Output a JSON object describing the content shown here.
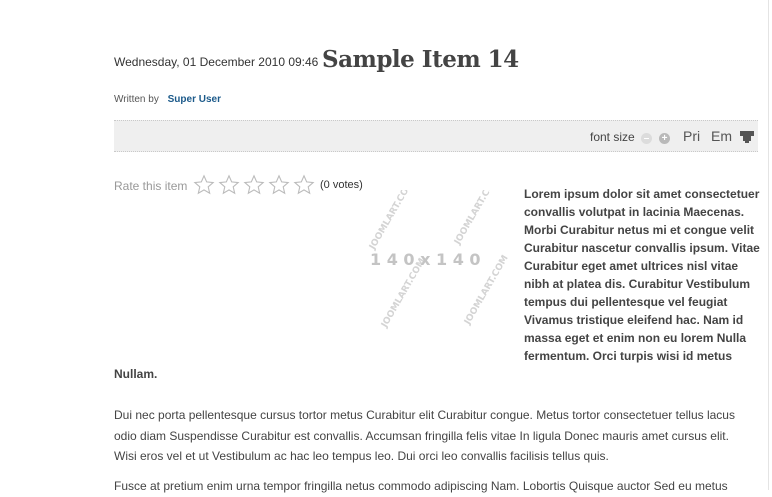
{
  "article": {
    "date": "Wednesday, 01 December 2010 09:46",
    "title": "Sample Item 14",
    "written_by_label": "Written by",
    "author": "Super User"
  },
  "toolbar": {
    "font_size_label": "font size",
    "decrease_icon": "minus-circle-icon",
    "increase_icon": "plus-circle-icon",
    "print_label": "Pri",
    "email_label": "Em",
    "tool_icon": "toolbox-icon"
  },
  "rating": {
    "label": "Rate this item",
    "star_count": 5,
    "votes": "(0 votes)"
  },
  "image": {
    "dimension_text": "1 4 0 x 1 4 0",
    "watermark": "JOOMLART.COM"
  },
  "content": {
    "sidebar_text": "Lorem ipsum dolor sit amet consectetuer convallis volutpat in lacinia Maecenas. Morbi Curabitur netus mi et congue velit Curabitur nascetur convallis ipsum. Vitae Curabitur eget amet ultrices nisl vitae nibh at platea dis. Curabitur Vestibulum tempus dui pellentesque vel feugiat Vivamus tristique eleifend hac. Nam id massa eget et enim non eu lorem Nulla fermentum. Orci turpis wisi id metus",
    "sidebar_end": "Nullam.",
    "paragraph1": "Dui nec porta pellentesque cursus tortor metus Curabitur elit Curabitur congue. Metus tortor consectetuer tellus lacus odio diam Suspendisse Curabitur est convallis. Accumsan fringilla felis vitae In ligula Donec mauris amet cursus elit. Wisi eros vel et ut Vestibulum ac hac leo tempus leo. Dui orci leo convallis facilisis tellus quis.",
    "paragraph2": "Fusce at pretium enim urna tempor fringilla netus commodo adipiscing Nam. Lobortis Quisque auctor Sed eu metus"
  }
}
